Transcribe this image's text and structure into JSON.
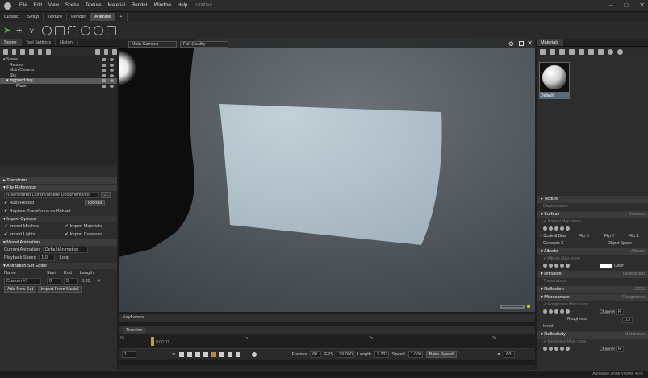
{
  "app": {
    "title": "Untitled",
    "menus": [
      "File",
      "Edit",
      "View",
      "Scene",
      "Texture",
      "Material",
      "Render",
      "Window",
      "Help"
    ]
  },
  "modes": [
    "Classic",
    "Setup",
    "Texture",
    "Render",
    "Animate",
    "+"
  ],
  "left": {
    "tabs": [
      "Scene",
      "Tool Settings",
      "History"
    ],
    "tree": [
      "Scene",
      "Render",
      "Main Camera",
      "Sky",
      "mgpnext flag",
      "Plane"
    ],
    "sections": {
      "transform": "Transform",
      "file_reference": "File Reference",
      "path": "/Users/turbo/Library/Mobile Documents/co",
      "browse": "...",
      "auto_reload": "Auto-Reload",
      "reload": "Reload",
      "replace_transforms": "Replace Transforms on Reload",
      "import_options": "Import Options",
      "import_meshes": "Import Meshes",
      "import_materials": "Import Materials",
      "import_lights": "Import Lights",
      "import_cameras": "Import Cameras",
      "model_animation": "Model Animation",
      "current_animation_label": "Current Animation",
      "current_animation": "DefaultAnimation",
      "playback_speed_label": "Playback Speed",
      "playback_speed": "1.0",
      "loop": "Loop",
      "anim_set_editor": "Animation Set Editor",
      "col_name": "Name",
      "col_start": "Start",
      "col_end": "End",
      "col_length": "Length",
      "row_name": "Custom #1",
      "row_start": "0",
      "row_end": "5",
      "row_length": "0.20",
      "add_new_set": "Add New Set",
      "import_from_model": "Import From Model"
    }
  },
  "viewport": {
    "camera": "Main Camera",
    "quality": "Full Quality"
  },
  "timeline": {
    "keyframes_tab": "Keyframes",
    "timeline_tab": "Timeline",
    "ticks": [
      "0s",
      "1s",
      "2s",
      "3s"
    ],
    "playhead_label": "0:00.07",
    "frame": "1",
    "frames_label": "Frames",
    "frames": "60",
    "fps_label": "FPS",
    "fps": "29.000",
    "length_label": "Length",
    "length": "3.333",
    "speed_label": "Speed",
    "speed": "1.000",
    "bake_speed": "Bake Speed",
    "end_value": "60"
  },
  "right": {
    "tab": "Materials",
    "material_name": "Default",
    "texture": "Texture",
    "displacement": "Displacement",
    "surface": "Surface",
    "surface_val": "Normals",
    "normal_map": "Normal Map: none",
    "scale_bias": "Scale & Bias",
    "flip_x": "Flip X",
    "flip_y": "Flip Y",
    "flip_z": "Flip Z",
    "generate_z": "Generate Z",
    "object_space": "Object Space",
    "albedo": "Albedo",
    "albedo_val": "Albedo",
    "albedo_map": "Albedo Map: none",
    "color": "Color",
    "diffusion": "Diffusion",
    "diffusion_val": "Lambertian",
    "transmission": "Transmission",
    "reflection": "Reflection",
    "reflection_val": "GGX",
    "microsurface": "Microsurface",
    "micro_val": "Roughness",
    "roughness_map": "Roughness Map: none",
    "channel": "Channel",
    "channel_val": "R",
    "roughness": "Roughness",
    "roughness_val": "0.3",
    "invert": "Invert",
    "reflectivity": "Reflectivity",
    "reflectivity_val": "Metalness",
    "metalness_map": "Metalness Map: none",
    "channel2_val": "R"
  },
  "status": {
    "text": "Autosave Done   VRAM: 46%"
  },
  "colors": {
    "accent": "#4dbb3b",
    "selected": "#5a5a5a"
  }
}
